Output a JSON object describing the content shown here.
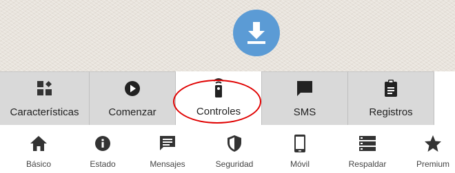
{
  "download": {
    "icon": "download-icon",
    "color": "#5b9bd5"
  },
  "tabs": [
    {
      "label": "Características",
      "icon": "features-icon"
    },
    {
      "label": "Comenzar",
      "icon": "play-icon"
    },
    {
      "label": "Controles",
      "icon": "remote-icon",
      "active": true
    },
    {
      "label": "SMS",
      "icon": "message-icon"
    },
    {
      "label": "Registros",
      "icon": "clipboard-icon"
    }
  ],
  "nav": [
    {
      "label": "Básico",
      "icon": "home-icon"
    },
    {
      "label": "Estado",
      "icon": "info-icon"
    },
    {
      "label": "Mensajes",
      "icon": "message-icon"
    },
    {
      "label": "Seguridad",
      "icon": "shield-icon"
    },
    {
      "label": "Móvil",
      "icon": "phone-icon"
    },
    {
      "label": "Respaldar",
      "icon": "storage-icon"
    },
    {
      "label": "Premium",
      "icon": "star-icon"
    }
  ],
  "annotation_color": "#e00000"
}
